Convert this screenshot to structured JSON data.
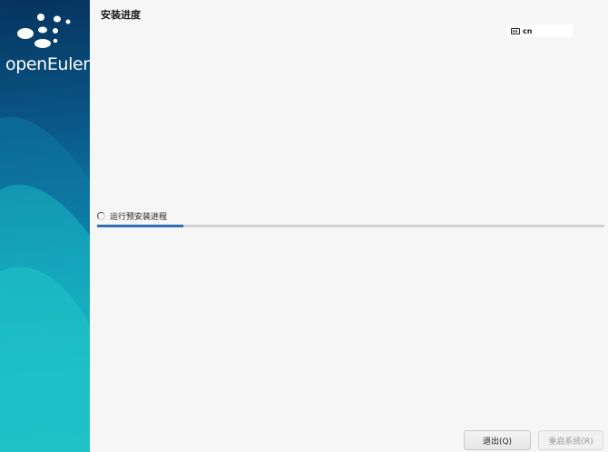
{
  "sidebar": {
    "logo_text": "openEuler",
    "logo_icon": "openeuler-dots-icon"
  },
  "header": {
    "title": "安装进度",
    "keyboard_layout": "cn",
    "keyboard_icon": "keyboard-icon"
  },
  "progress": {
    "status_text": "运行预安装进程",
    "spinner_icon": "spinner-icon",
    "fraction": 0.17
  },
  "buttons": {
    "quit_label": "退出(Q)",
    "reboot_label": "重启系统(R)",
    "reboot_enabled": false
  },
  "colors": {
    "progress_fill": "#2e6fb7",
    "sidebar_gradient_top": "#06335e",
    "sidebar_gradient_bottom": "#1cc3c6"
  }
}
